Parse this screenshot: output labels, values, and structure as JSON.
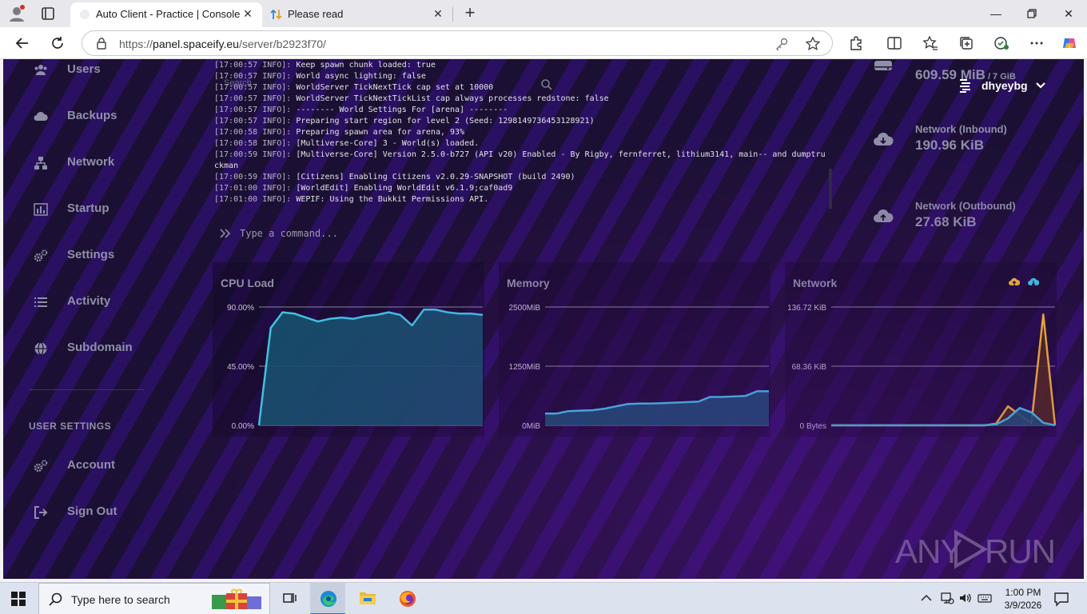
{
  "browser": {
    "tabs": [
      {
        "title": "Auto Client - Practice | Console",
        "active": true
      },
      {
        "title": "Please read",
        "active": false
      }
    ],
    "url_scheme": "https://",
    "url_host": "panel.spaceify.eu",
    "url_path": "/server/b2923f70/"
  },
  "sidebar": {
    "items": [
      {
        "label": "Users",
        "icon": "users-icon"
      },
      {
        "label": "Backups",
        "icon": "cloud-icon"
      },
      {
        "label": "Network",
        "icon": "network-icon"
      },
      {
        "label": "Startup",
        "icon": "chart-bar-icon"
      },
      {
        "label": "Settings",
        "icon": "gears-icon"
      },
      {
        "label": "Activity",
        "icon": "list-icon"
      },
      {
        "label": "Subdomain",
        "icon": "globe-icon"
      }
    ],
    "section_title": "USER SETTINGS",
    "user_items": [
      {
        "label": "Account",
        "icon": "gears-icon"
      },
      {
        "label": "Sign Out",
        "icon": "sign-out-icon"
      }
    ]
  },
  "console": {
    "ghost_text": "Search",
    "lines": [
      {
        "ts": "[17:00:57 INFO]:",
        "msg": " Keep spawn chunk loaded: true"
      },
      {
        "ts": "[17:00:57 INFO]:",
        "msg": " World async lighting: false"
      },
      {
        "ts": "[17:00:57 INFO]:",
        "msg": " WorldServer TickNextTick cap set at 10000"
      },
      {
        "ts": "[17:00:57 INFO]:",
        "msg": " WorldServer TickNextTickList cap always processes redstone: false"
      },
      {
        "ts": "[17:00:57 INFO]:",
        "msg": " -------- World Settings For [arena] --------"
      },
      {
        "ts": "[17:00:57 INFO]:",
        "msg": " Preparing start region for level 2 (Seed: 1298149736453128921)"
      },
      {
        "ts": "[17:00:58 INFO]:",
        "msg": " Preparing spawn area for arena, 93%"
      },
      {
        "ts": "[17:00:58 INFO]:",
        "msg": " [Multiverse-Core] 3 - World(s) loaded."
      },
      {
        "ts": "[17:00:59 INFO]:",
        "msg": " [Multiverse-Core] Version 2.5.0-b727 (API v20) Enabled - By Rigby, fernferret, lithium3141, main-- and dumptru"
      },
      {
        "ts": "",
        "msg": "ckman"
      },
      {
        "ts": "[17:00:59 INFO]:",
        "msg": " [Citizens] Enabling Citizens v2.0.29-SNAPSHOT (build 2490)"
      },
      {
        "ts": "[17:01:00 INFO]:",
        "msg": " [WorldEdit] Enabling WorldEdit v6.1.9;caf0ad9"
      },
      {
        "ts": "[17:01:00 INFO]:",
        "msg": " WEPIF: Using the Bukkit Permissions API."
      }
    ],
    "command_placeholder": "Type a command..."
  },
  "stats": {
    "memory_value": "609.59 MiB",
    "memory_limit": " / 7 GiB",
    "net_in_label": "Network (Inbound)",
    "net_in_value": "190.96 KiB",
    "net_out_label": "Network (Outbound)",
    "net_out_value": "27.68 KiB"
  },
  "user": {
    "name": "dhyeybg"
  },
  "colors": {
    "accent_cyan": "#3fc6e8",
    "accent_orange": "#f5b82e",
    "fill_cyan": "#14526a",
    "fill_orange": "#4a2a10",
    "muted_text": "#8f90a8"
  },
  "chart_data": [
    {
      "type": "area",
      "title": "CPU Load",
      "yticks": [
        "90.00%",
        "45.00%",
        "0.00%"
      ],
      "ylim": [
        0,
        90
      ],
      "x": [
        0,
        1,
        2,
        3,
        4,
        5,
        6,
        7,
        8,
        9,
        10,
        11,
        12,
        13,
        14,
        15,
        16,
        17,
        18,
        19
      ],
      "series": [
        {
          "values": [
            0,
            74,
            86,
            85,
            82,
            79,
            81,
            82,
            81,
            83,
            84,
            86,
            84,
            76,
            88,
            88,
            86,
            85,
            85,
            84
          ]
        }
      ]
    },
    {
      "type": "area",
      "title": "Memory",
      "yticks": [
        "2500MiB",
        "1250MiB",
        "0MiB"
      ],
      "ylim": [
        0,
        2500
      ],
      "x": [
        0,
        1,
        2,
        3,
        4,
        5,
        6,
        7,
        8,
        9,
        10,
        11,
        12,
        13,
        14,
        15,
        16,
        17,
        18,
        19
      ],
      "series": [
        {
          "values": [
            250,
            250,
            300,
            310,
            320,
            350,
            400,
            450,
            460,
            460,
            470,
            480,
            490,
            500,
            600,
            600,
            610,
            620,
            720,
            720
          ]
        }
      ]
    },
    {
      "type": "area",
      "title": "Network",
      "yticks": [
        "136.72 KiB",
        "68.36 KiB",
        "0 Bytes"
      ],
      "ylim": [
        0,
        136.72
      ],
      "x": [
        0,
        1,
        2,
        3,
        4,
        5,
        6,
        7,
        8,
        9,
        10,
        11,
        12,
        13,
        14,
        15,
        16,
        17,
        18,
        19
      ],
      "series": [
        {
          "values": [
            0,
            0,
            0,
            0,
            0,
            0,
            0,
            0,
            0,
            0,
            0,
            0,
            0,
            0,
            1,
            8,
            20,
            15,
            3,
            0
          ],
          "color_key": "accent_cyan"
        },
        {
          "values": [
            0,
            0,
            0,
            0,
            0,
            0,
            0,
            0,
            0,
            0,
            0,
            0,
            0,
            0,
            2,
            22,
            12,
            3,
            128,
            0
          ],
          "color_key": "accent_orange"
        }
      ]
    }
  ],
  "watermark": {
    "left": "ANY",
    "right": "RUN"
  },
  "taskbar": {
    "search_placeholder": "Type here to search",
    "time": "1:00 PM",
    "date": "3/9/2026"
  }
}
